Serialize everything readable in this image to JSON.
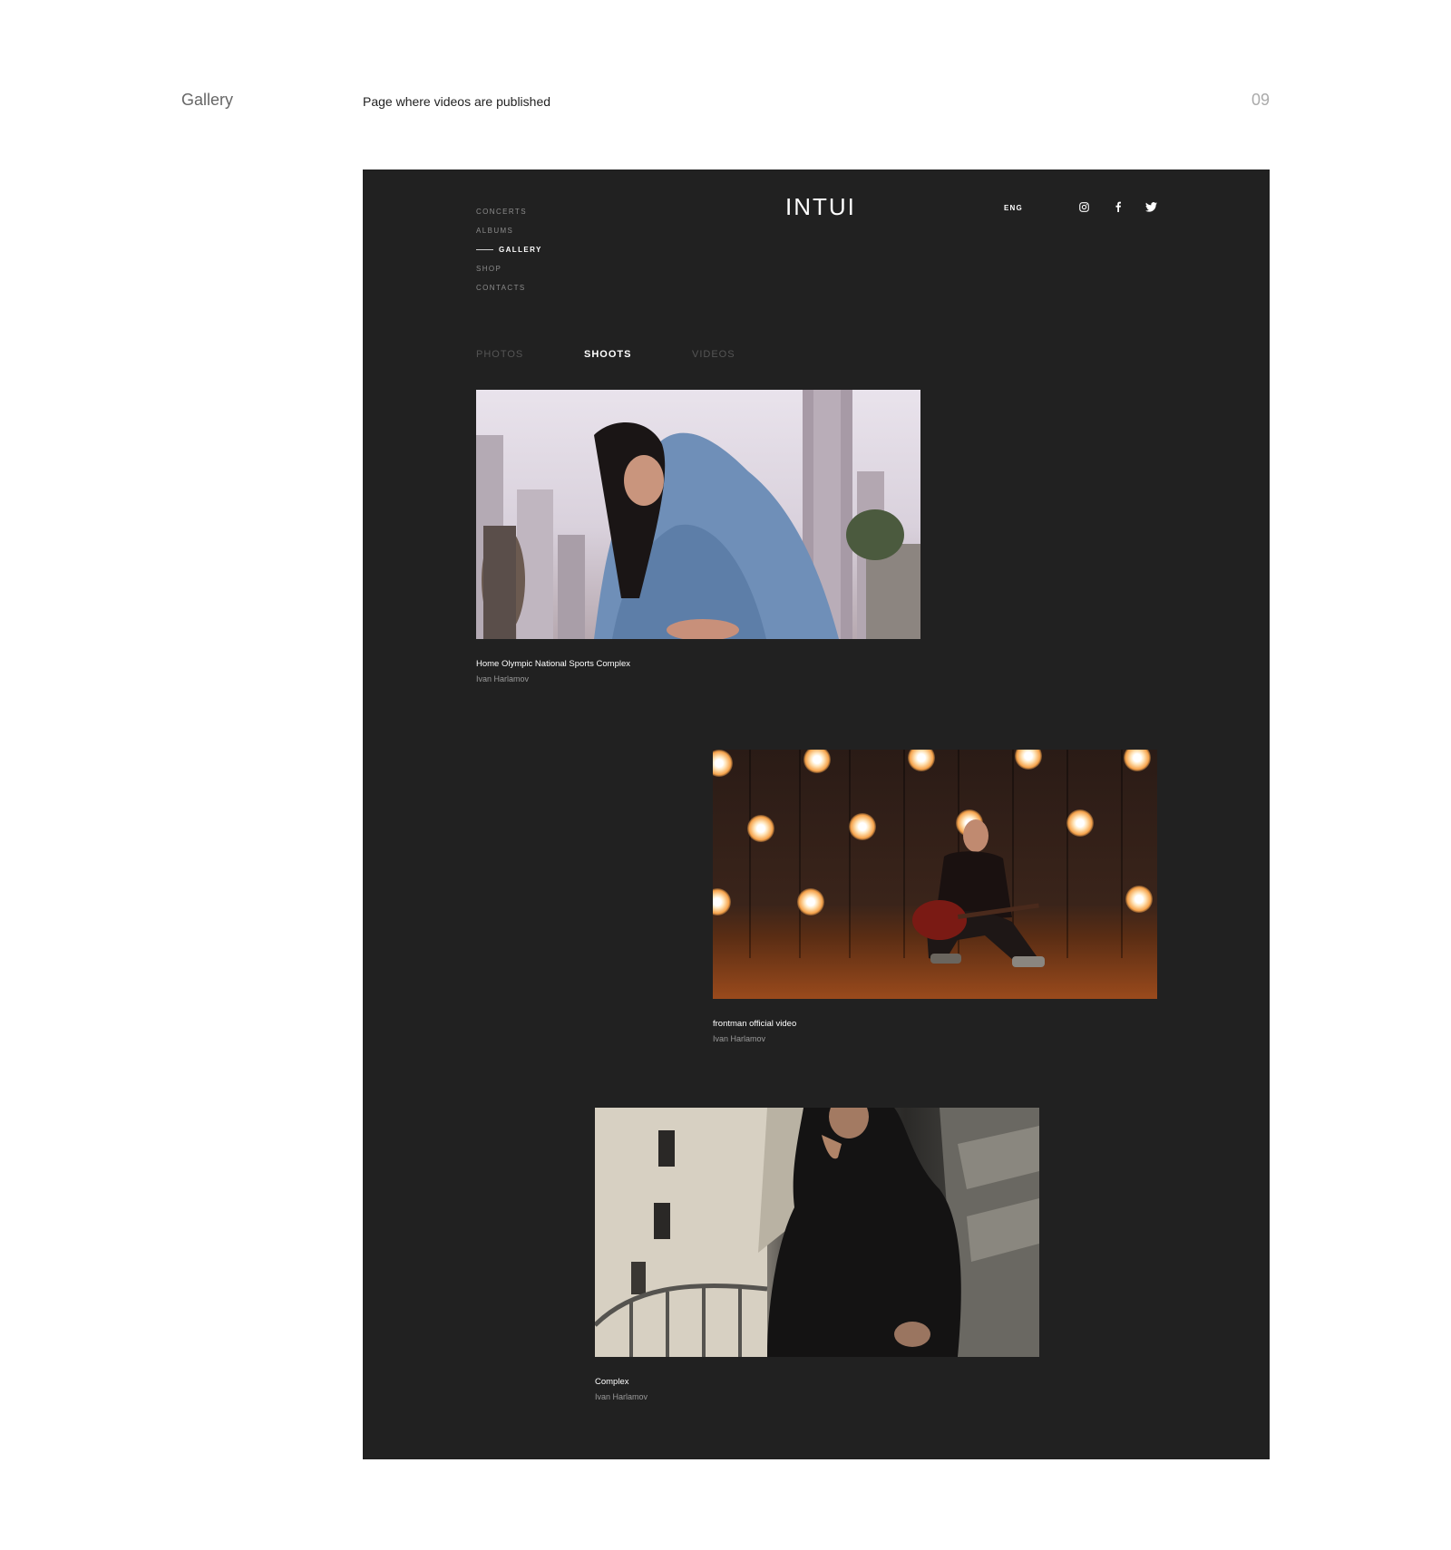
{
  "presentation": {
    "section_title": "Gallery",
    "description": "Page where videos are published",
    "page_number": "09"
  },
  "site": {
    "logo": "INTUI",
    "language": "ENG",
    "nav": [
      {
        "label": "CONCERTS",
        "active": false
      },
      {
        "label": "ALBUMS",
        "active": false
      },
      {
        "label": "GALLERY",
        "active": true
      },
      {
        "label": "SHOP",
        "active": false
      },
      {
        "label": "CONTACTS",
        "active": false
      }
    ],
    "social": [
      "instagram-icon",
      "facebook-icon",
      "twitter-icon"
    ],
    "tabs": [
      {
        "label": "PHOTOS",
        "active": false
      },
      {
        "label": "SHOOTS",
        "active": true
      },
      {
        "label": "VIDEOS",
        "active": false
      }
    ],
    "items": [
      {
        "title": "Home Olympic National Sports Complex",
        "author": "Ivan Harlamov"
      },
      {
        "title": "frontman official video",
        "author": "Ivan Harlamov"
      },
      {
        "title": "Complex",
        "author": "Ivan Harlamov"
      }
    ]
  },
  "colors": {
    "background": "#ffffff",
    "mockup_background": "#212121",
    "text_active": "#ffffff",
    "text_muted": "#8c8c8c"
  }
}
